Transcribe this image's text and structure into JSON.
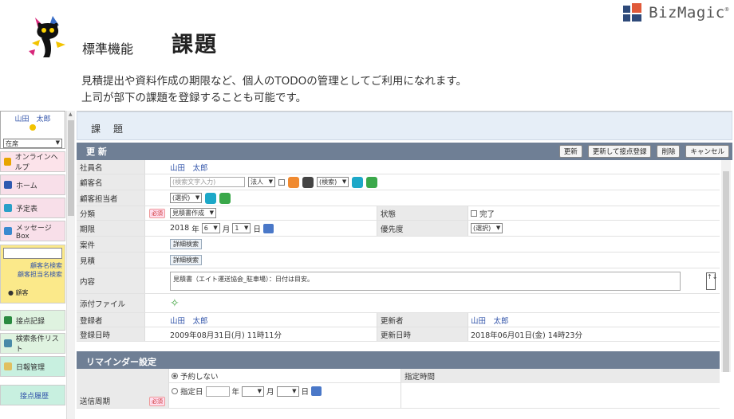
{
  "brand": {
    "name": "BizMagic",
    "reg": "®"
  },
  "header": {
    "std_function": "標準機能",
    "title": "課題",
    "desc_line1": "見積提出や資料作成の期限など、個人のTODOの管理としてご利用になれます。",
    "desc_line2": "上司が部下の課題を登録することも可能です。"
  },
  "sidebar": {
    "user_name": "山田　太郎",
    "status": "在席",
    "items": [
      {
        "label": "オンラインヘルプ"
      },
      {
        "label": "ホーム"
      },
      {
        "label": "予定表"
      },
      {
        "label": "メッセージBox"
      }
    ],
    "search_labels": [
      "顧客名検索",
      "顧客担当名検索"
    ],
    "customer": "顧客",
    "items2": [
      {
        "label": "接点記録"
      },
      {
        "label": "検索条件リスト"
      },
      {
        "label": "日報管理"
      }
    ],
    "bottom": "接点履歴"
  },
  "main": {
    "title": "課　題",
    "section": "更 新",
    "buttons": [
      "更新",
      "更新して接点登録",
      "削除",
      "キャンセル"
    ],
    "required_badge": "必須",
    "fields": {
      "employee_label": "社員名",
      "employee_value": "山田　太郎",
      "customer_label": "顧客名",
      "customer_placeholder": "(検索文字入力)",
      "customer_type": "法人",
      "customer_search": "(検索)",
      "contact_label": "顧客担当者",
      "contact_select": "(選択)",
      "category_label": "分類",
      "category_value": "見積書作成",
      "status_label": "状態",
      "status_value": "完了",
      "deadline_label": "期限",
      "deadline_year": "2018",
      "deadline_year_unit": "年",
      "deadline_month": "6",
      "deadline_month_unit": "月",
      "deadline_day": "1",
      "deadline_day_unit": "日",
      "priority_label": "優先度",
      "priority_value": "(選択)",
      "case_label": "案件",
      "case_btn": "詳細検索",
      "estimate_label": "見積",
      "estimate_btn": "詳細検索",
      "content_label": "内容",
      "content_value": "見積書（エイト運送協会_駐車場）：日付は目安。",
      "attach_label": "添付ファイル",
      "registrant_label": "登録者",
      "registrant_value": "山田　太郎",
      "updater_label": "更新者",
      "updater_value": "山田　太郎",
      "reg_date_label": "登録日時",
      "reg_date_value": "2009年08月31日(月) 11時11分",
      "upd_date_label": "更新日時",
      "upd_date_value": "2018年06月01日(金) 14時23分"
    },
    "reminder": {
      "title": "リマインダー設定",
      "option_none": "予約しない",
      "option_date": "指定日",
      "unit_year": "年",
      "unit_month": "月",
      "unit_day": "日",
      "time_label": "指定時間",
      "send_label": "送信周期"
    }
  }
}
